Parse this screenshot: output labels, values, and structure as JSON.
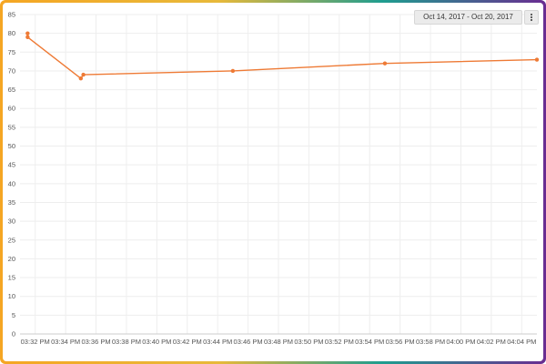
{
  "toolbar": {
    "date_range": "Oct 14, 2017 - Oct 20, 2017",
    "menu_icon": "more-vertical-icon"
  },
  "colors": {
    "line": "#ee7a35",
    "grid": "#eeeeee",
    "axis_text": "#555555"
  },
  "chart_data": {
    "type": "line",
    "title": "",
    "xlabel": "",
    "ylabel": "",
    "ylim": [
      0,
      85
    ],
    "yticks": [
      0,
      5,
      10,
      15,
      20,
      25,
      30,
      35,
      40,
      45,
      50,
      55,
      60,
      65,
      70,
      75,
      80,
      85
    ],
    "xlim": [
      "03:31 PM",
      "04:05 PM"
    ],
    "xtick_labels": [
      "03:32 PM",
      "03:34 PM",
      "03:36 PM",
      "03:38 PM",
      "03:40 PM",
      "03:42 PM",
      "03:44 PM",
      "03:46 PM",
      "03:48 PM",
      "03:50 PM",
      "03:52 PM",
      "03:54 PM",
      "03:56 PM",
      "03:58 PM",
      "04:00 PM",
      "04:02 PM",
      "04:04 PM"
    ],
    "grid": true,
    "series": [
      {
        "color": "#ee7a35",
        "points": [
          {
            "x": "03:31:30 PM",
            "y": 80
          },
          {
            "x": "03:31:30 PM",
            "y": 79
          },
          {
            "x": "03:35 PM",
            "y": 68
          },
          {
            "x": "03:35:10 PM",
            "y": 69
          },
          {
            "x": "03:45 PM",
            "y": 70
          },
          {
            "x": "03:55 PM",
            "y": 72
          },
          {
            "x": "04:05 PM",
            "y": 73
          }
        ]
      }
    ]
  }
}
